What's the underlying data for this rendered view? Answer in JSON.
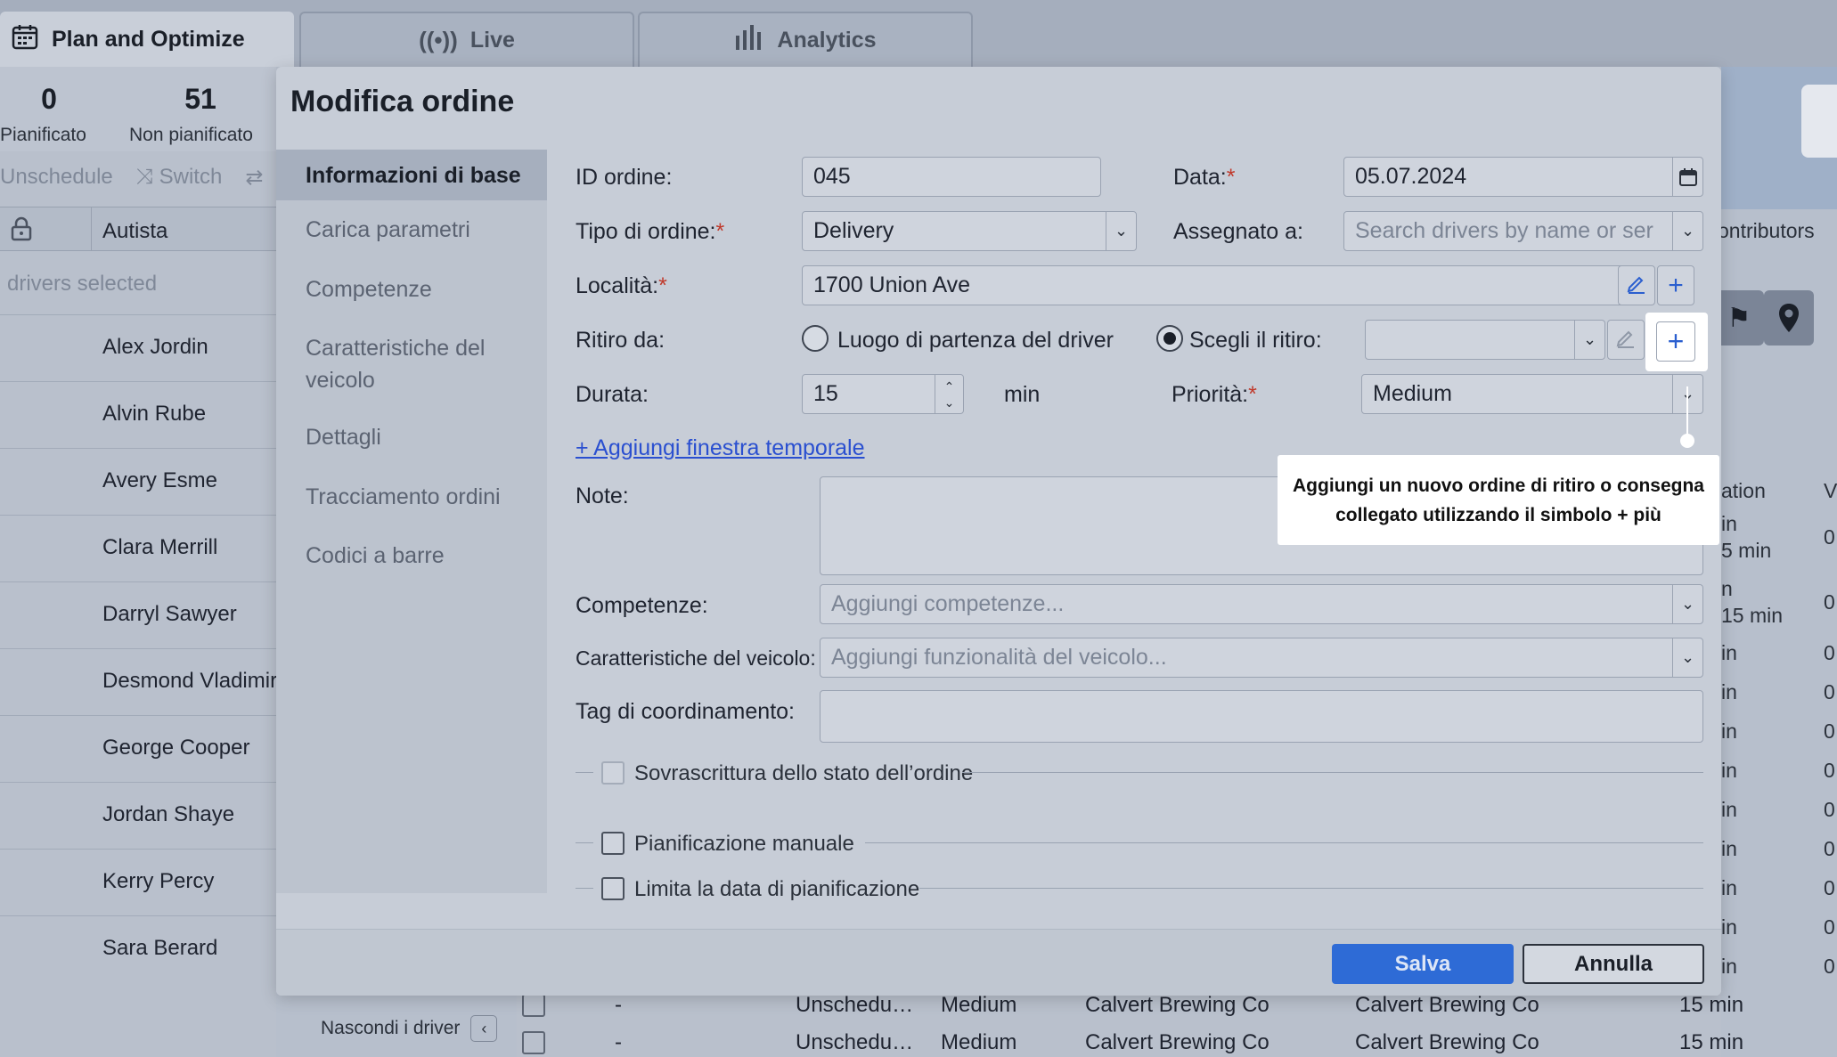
{
  "tabs": [
    {
      "label": "Plan and Optimize",
      "icon": "calendar-icon",
      "active": true
    },
    {
      "label": "Live",
      "icon": "broadcast-icon",
      "active": false
    },
    {
      "label": "Analytics",
      "icon": "bar-chart-icon",
      "active": false
    }
  ],
  "stats": {
    "planned": {
      "value": "0",
      "label": "Pianificato"
    },
    "unplanned": {
      "value": "51",
      "label": "Non pianificato"
    }
  },
  "actions": {
    "unschedule": "Unschedule",
    "switch": "Switch"
  },
  "driver_table": {
    "header": "Autista",
    "selection_text": "drivers selected",
    "drivers": [
      "Alex Jordin",
      "Alvin Rube",
      "Avery Esme",
      "Clara Merrill",
      "Darryl Sawyer",
      "Desmond Vladimir",
      "George Cooper",
      "Jordan Shaye",
      "Kerry Percy",
      "Sara Berard"
    ]
  },
  "hide_drivers": "Nascondi i driver",
  "right_strip": {
    "contributors": "ontributors",
    "col_header": "ation",
    "col_header2": "V",
    "rows": [
      {
        "a": "in",
        "b": "5 min",
        "v": "0"
      },
      {
        "a": "n",
        "b": "15 min",
        "v": "0"
      },
      {
        "a": "in",
        "b": "",
        "v": "0"
      },
      {
        "a": "in",
        "b": "",
        "v": "0"
      },
      {
        "a": "in",
        "b": "",
        "v": "0"
      },
      {
        "a": "in",
        "b": "",
        "v": "0"
      },
      {
        "a": "in",
        "b": "",
        "v": "0"
      },
      {
        "a": "in",
        "b": "",
        "v": "0"
      },
      {
        "a": "in",
        "b": "",
        "v": "0"
      },
      {
        "a": "in",
        "b": "",
        "v": "0"
      },
      {
        "a": "in",
        "b": "",
        "v": "0"
      }
    ]
  },
  "bottom_rows": [
    {
      "dash": "-",
      "status": "Unschedu…",
      "priority": "Medium",
      "from": "Calvert Brewing Co",
      "to": "Calvert Brewing Co",
      "duration": "15 min"
    },
    {
      "dash": "-",
      "status": "Unschedu…",
      "priority": "Medium",
      "from": "Calvert Brewing Co",
      "to": "Calvert Brewing Co",
      "duration": "15 min"
    }
  ],
  "modal": {
    "title": "Modifica ordine",
    "nav": [
      "Informazioni di base",
      "Carica parametri",
      "Competenze",
      "Caratteristiche del veicolo",
      "Dettagli",
      "Tracciamento ordini",
      "Codici a barre"
    ],
    "fields": {
      "order_id": {
        "label": "ID ordine:",
        "value": "045"
      },
      "date": {
        "label": "Data:",
        "value": "05.07.2024"
      },
      "order_type": {
        "label": "Tipo di ordine:",
        "value": "Delivery"
      },
      "assigned_to": {
        "label": "Assegnato a:",
        "placeholder": "Search drivers by name or ser"
      },
      "location": {
        "label": "Località:",
        "value": "1700 Union Ave"
      },
      "pickup_from": {
        "label": "Ritiro da:",
        "option_driver": "Luogo di partenza del driver",
        "option_choose": "Scegli il ritiro:",
        "selected": "choose"
      },
      "duration": {
        "label": "Durata:",
        "value": "15",
        "unit": "min"
      },
      "priority": {
        "label": "Priorità:",
        "value": "Medium"
      },
      "add_time_window": "+ Aggiungi finestra temporale",
      "notes": {
        "label": "Note:"
      },
      "skills": {
        "label": "Competenze:",
        "placeholder": "Aggiungi competenze..."
      },
      "vehicle_features": {
        "label": "Caratteristiche del veicolo:",
        "placeholder": "Aggiungi funzionalità del veicolo..."
      },
      "coordination_tag": {
        "label": "Tag di coordinamento:"
      }
    },
    "checkboxes": [
      {
        "label": "Sovrascrittura dello stato dell’ordine",
        "checked": false
      },
      {
        "label": "Pianificazione manuale",
        "checked": false
      },
      {
        "label": "Limita la data di pianificazione",
        "checked": false
      }
    ],
    "buttons": {
      "save": "Salva",
      "cancel": "Annulla"
    }
  },
  "tooltip": {
    "line1": "Aggiungi un nuovo ordine di ritiro o consegna",
    "line2": "collegato utilizzando il simbolo + più"
  },
  "colors": {
    "primary": "#2e6bd6",
    "required": "#c0392b",
    "link": "#2a4fd0"
  }
}
